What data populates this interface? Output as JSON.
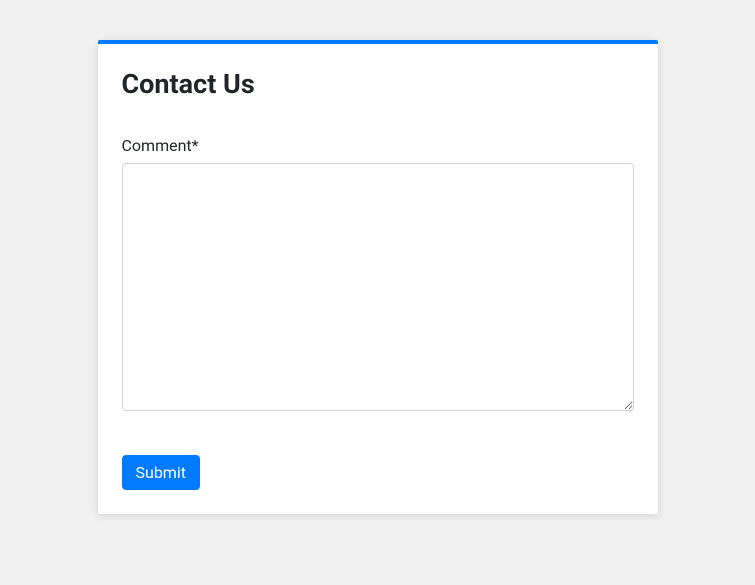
{
  "form": {
    "title": "Contact Us",
    "comment_label": "Comment*",
    "comment_value": "",
    "submit_label": "Submit"
  }
}
